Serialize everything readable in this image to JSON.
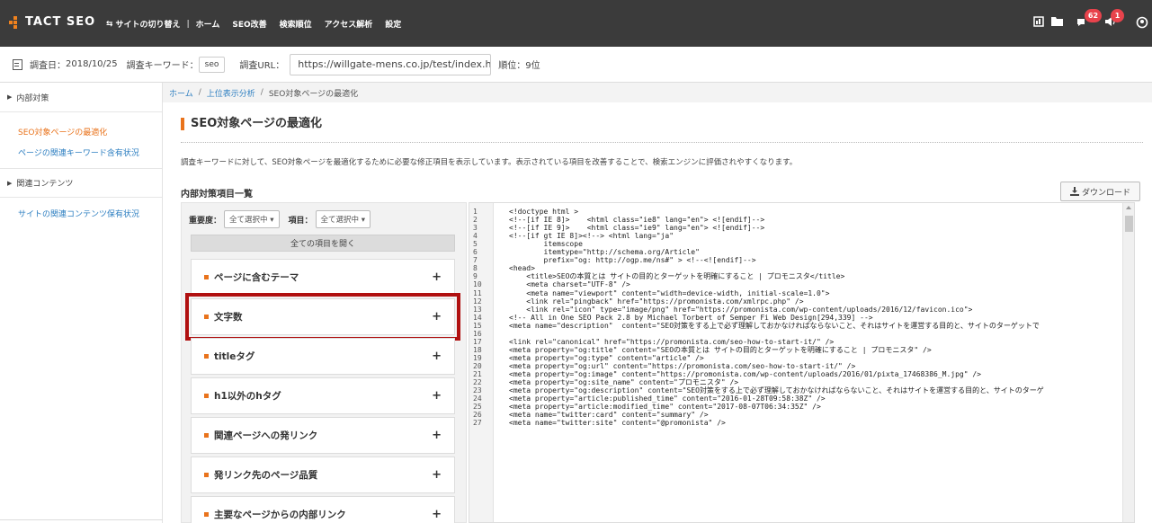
{
  "app": {
    "logo": "TACT SEO"
  },
  "nav": {
    "switch": "サイトの切り替え",
    "separator": "|",
    "items": [
      "ホーム",
      "SEO改善",
      "検索順位",
      "アクセス解析",
      "設定"
    ]
  },
  "badges": {
    "notifications": "62",
    "alerts": "1"
  },
  "info": {
    "date_label": "調査日：",
    "date_value": "2018/10/25",
    "keyword_label": "調査キーワード：",
    "keyword_value": "seo",
    "url_label": "調査URL：",
    "url_value": "https://willgate-mens.co.jp/test/index.h..",
    "rank": "順位：9位"
  },
  "sidebar": {
    "section1": "内部対策",
    "links1": [
      "SEO対象ページの最適化",
      "ページの関連キーワード含有状況"
    ],
    "section2": "関連コンテンツ",
    "links2": [
      "サイトの関連コンテンツ保有状況"
    ]
  },
  "breadcrumb": {
    "home": "ホーム",
    "sep": "/",
    "mid": "上位表示分析",
    "current": "SEO対象ページの最適化"
  },
  "page_title": "SEO対象ページの最適化",
  "description": "調査キーワードに対して、SEO対象ページを最適化するために必要な修正項目を表示しています。表示されている項目を改善することで、検索エンジンに評価されやすくなります。",
  "section_title": "内部対策項目一覧",
  "download_label": "ダウンロード",
  "filters": {
    "importance_label": "重要度：",
    "importance_value": "全て選択中 ▾",
    "item_label": "項目：",
    "item_value": "全て選択中 ▾"
  },
  "open_all": "全ての項目を開く",
  "accordion": [
    "ページに含むテーマ",
    "文字数",
    "titleタグ",
    "h1以外のhタグ",
    "関連ページへの発リンク",
    "発リンク先のページ品質",
    "主要なページからの内部リンク"
  ],
  "accordion_plus": "+",
  "code_lines": [
    "<!doctype html >",
    "<!--[if IE 8]>    <html class=\"ie8\" lang=\"en\"> <![endif]-->",
    "<!--[if IE 9]>    <html class=\"ie9\" lang=\"en\"> <![endif]-->",
    "<!--[if gt IE 8]><!--> <html lang=\"ja\"",
    "        itemscope",
    "        itemtype=\"http://schema.org/Article\"",
    "        prefix=\"og: http://ogp.me/ns#\" > <!--<![endif]-->",
    "<head>",
    "    <title>SEOの本質とは サイトの目的とターゲットを明確にすること | プロモニスタ</title>",
    "    <meta charset=\"UTF-8\" />",
    "    <meta name=\"viewport\" content=\"width=device-width, initial-scale=1.0\">",
    "    <link rel=\"pingback\" href=\"https://promonista.com/xmlrpc.php\" />",
    "    <link rel=\"icon\" type=\"image/png\" href=\"https://promonista.com/wp-content/uploads/2016/12/favicon.ico\">",
    "<!-- All in One SEO Pack 2.8 by Michael Torbert of Semper Fi Web Design[294,339] -->",
    "<meta name=\"description\"  content=\"SEO対策をする上で必ず理解しておかなければならないこと、それはサイトを運営する目的と、サイトのターゲットで",
    "",
    "<link rel=\"canonical\" href=\"https://promonista.com/seo-how-to-start-it/\" />",
    "<meta property=\"og:title\" content=\"SEOの本質とは サイトの目的とターゲットを明確にすること | プロモニスタ\" />",
    "<meta property=\"og:type\" content=\"article\" />",
    "<meta property=\"og:url\" content=\"https://promonista.com/seo-how-to-start-it/\" />",
    "<meta property=\"og:image\" content=\"https://promonista.com/wp-content/uploads/2016/01/pixta_17468386_M.jpg\" />",
    "<meta property=\"og:site_name\" content=\"プロモニスタ\" />",
    "<meta property=\"og:description\" content=\"SEO対策をする上で必ず理解しておかなければならないこと、それはサイトを運営する目的と、サイトのターゲ",
    "<meta property=\"article:published_time\" content=\"2016-01-28T09:58:38Z\" />",
    "<meta property=\"article:modified_time\" content=\"2017-08-07T06:34:35Z\" />",
    "<meta name=\"twitter:card\" content=\"summary\" />",
    "<meta name=\"twitter:site\" content=\"@promonista\" />"
  ],
  "colors": {
    "accent": "#e9731c",
    "link": "#2e7fc1",
    "highlight": "#b01010",
    "topbar": "#3b3b3b"
  }
}
